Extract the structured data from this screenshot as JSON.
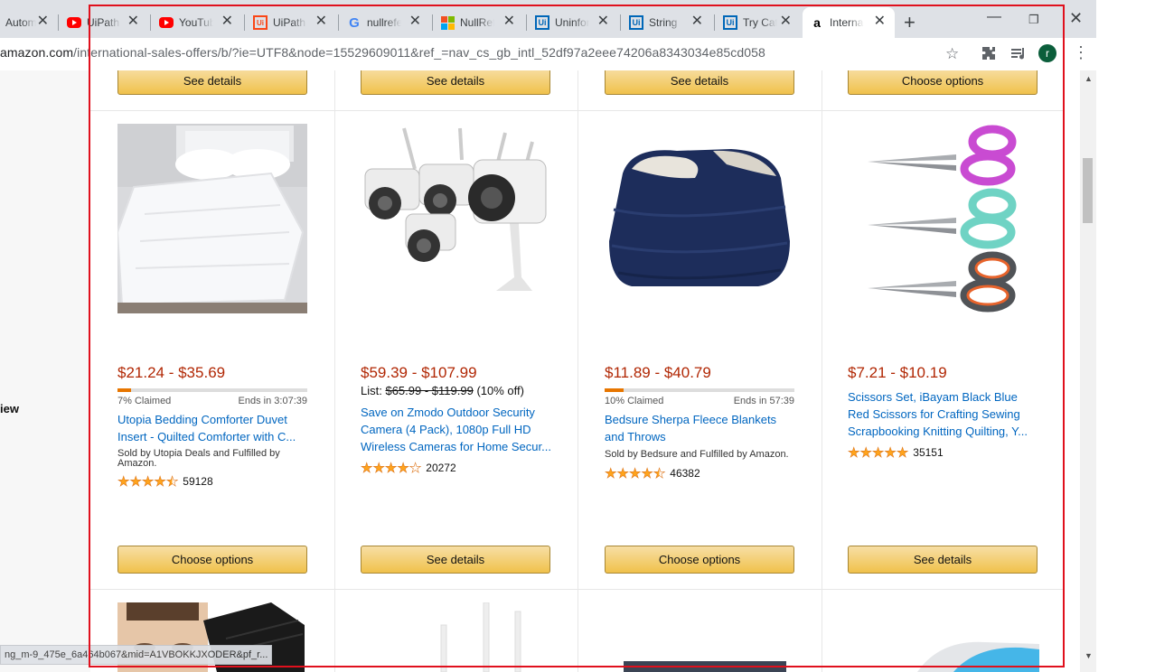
{
  "browser": {
    "tabs": [
      {
        "title": "Automa",
        "favicon": "generic"
      },
      {
        "title": "UiPath",
        "favicon": "youtube"
      },
      {
        "title": "YouTube",
        "favicon": "youtube"
      },
      {
        "title": "UiPath",
        "favicon": "uipath"
      },
      {
        "title": "nullrefe",
        "favicon": "google"
      },
      {
        "title": "NullRef",
        "favicon": "microsoft"
      },
      {
        "title": "Uninfor",
        "favicon": "uipath-blue"
      },
      {
        "title": "String",
        "favicon": "uipath-blue"
      },
      {
        "title": "Try Cat",
        "favicon": "uipath-blue"
      },
      {
        "title": "Interna",
        "favicon": "amazon",
        "active": true
      }
    ],
    "new_tab_label": "+",
    "close_glyph": "✕",
    "url_host": "amazon.com",
    "url_rest": "/international-sales-offers/b/?ie=UTF8&node=15529609011&ref_=nav_cs_gb_intl_52df97a2eee74206a8343034e85cd058",
    "profile_initial": "r",
    "status_url": "ng_m-9_475e_6a464b067&mid=A1VBOKKJXODER&pf_r..."
  },
  "page": {
    "left_panel_text": "iew",
    "top_buttons": [
      "See details",
      "See details",
      "See details",
      "Choose options"
    ],
    "products": [
      {
        "price": "$21.24 - $35.69",
        "claimed": "7% Claimed",
        "claimed_pct": 7,
        "ends": "Ends in 3:07:39",
        "title": "Utopia Bedding Comforter Duvet Insert - Quilted Comforter with C...",
        "sold_by": "Sold by Utopia Deals and Fulfilled by Amazon.",
        "rating": 4.5,
        "reviews": "59128",
        "button": "Choose options"
      },
      {
        "price": "$59.39 - $107.99",
        "list_label": "List:",
        "list_price": "$65.99 - $119.99",
        "discount": "(10% off)",
        "title": "Save on Zmodo Outdoor Security Camera (4 Pack), 1080p Full HD Wireless Cameras for Home Secur...",
        "rating": 4,
        "reviews": "20272",
        "button": "See details"
      },
      {
        "price": "$11.89 - $40.79",
        "claimed": "10% Claimed",
        "claimed_pct": 10,
        "ends": "Ends in 57:39",
        "title": "Bedsure Sherpa Fleece Blankets and Throws",
        "sold_by": "Sold by Bedsure and Fulfilled by Amazon.",
        "rating": 4.5,
        "reviews": "46382",
        "button": "Choose options"
      },
      {
        "price": "$7.21 - $10.19",
        "title": "Scissors Set, iBayam Black Blue Red Scissors for Crafting Sewing Scrapbooking Knitting Quilting, Y...",
        "rating": 5,
        "reviews": "35151",
        "button": "See details"
      }
    ]
  },
  "colors": {
    "price": "#b12704",
    "link": "#0066c0",
    "button": "#f0c14b",
    "frame": "#e0101d",
    "star": "#ffa41c"
  }
}
